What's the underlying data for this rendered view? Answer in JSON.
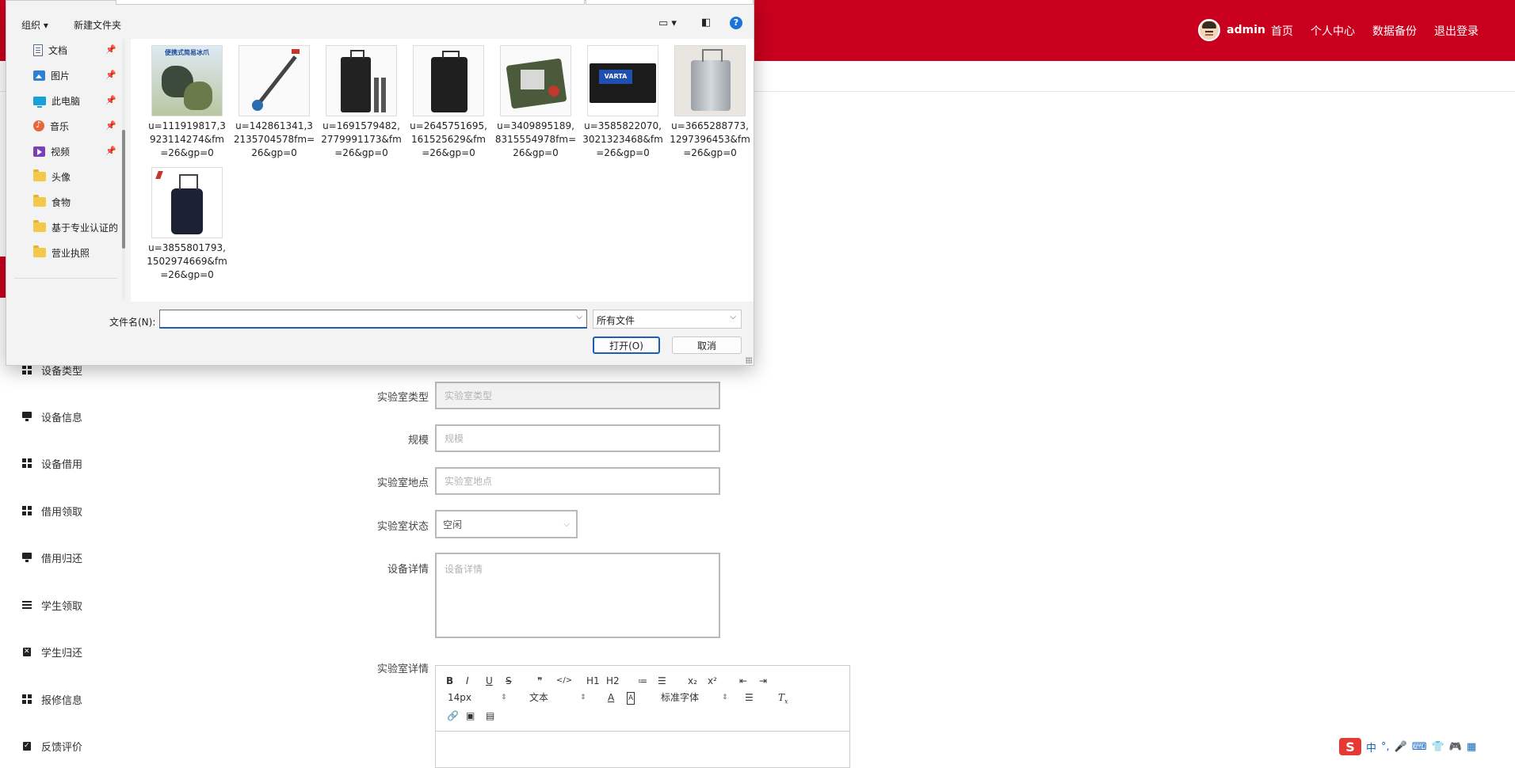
{
  "header": {
    "username": "admin",
    "nav": [
      "首页",
      "个人中心",
      "数据备份",
      "退出登录"
    ]
  },
  "sidebar": {
    "items": [
      {
        "label": "设备类型",
        "icon": "grid-icon"
      },
      {
        "label": "设备信息",
        "icon": "monitor-icon"
      },
      {
        "label": "设备借用",
        "icon": "grid-icon"
      },
      {
        "label": "借用领取",
        "icon": "grid-icon"
      },
      {
        "label": "借用归还",
        "icon": "monitor-icon"
      },
      {
        "label": "学生领取",
        "icon": "list-icon"
      },
      {
        "label": "学生归还",
        "icon": "clipboard-x-icon"
      },
      {
        "label": "报修信息",
        "icon": "grid-icon"
      },
      {
        "label": "反馈评价",
        "icon": "clipboard-check-icon"
      }
    ]
  },
  "form": {
    "lab_type": {
      "label": "实验室类型",
      "placeholder": "实验室类型"
    },
    "scale": {
      "label": "规模",
      "placeholder": "规模"
    },
    "location": {
      "label": "实验室地点",
      "placeholder": "实验室地点"
    },
    "status": {
      "label": "实验室状态",
      "value": "空闲"
    },
    "device_detail": {
      "label": "设备详情",
      "placeholder": "设备详情"
    },
    "lab_detail": {
      "label": "实验室详情"
    }
  },
  "editor": {
    "row1": [
      "B",
      "I",
      "U",
      "S",
      "❞",
      "</>",
      "H1",
      "H2",
      "≔",
      "☰",
      "x₂",
      "x²",
      "⇤",
      "⇥"
    ],
    "font_size": "14px",
    "text_type": "文本",
    "font_family": "标准字体"
  },
  "dialog": {
    "toolbar": {
      "organize": "组织 ▾",
      "new_folder": "新建文件夹"
    },
    "nav": [
      {
        "label": "文档",
        "icon": "document-icon",
        "pinned": true
      },
      {
        "label": "图片",
        "icon": "pictures-icon",
        "pinned": true
      },
      {
        "label": "此电脑",
        "icon": "computer-icon",
        "pinned": true
      },
      {
        "label": "音乐",
        "icon": "music-icon",
        "pinned": true
      },
      {
        "label": "视频",
        "icon": "video-icon",
        "pinned": true
      },
      {
        "label": "头像",
        "icon": "folder-icon",
        "pinned": false
      },
      {
        "label": "食物",
        "icon": "folder-icon",
        "pinned": false
      },
      {
        "label": "基于专业认证的",
        "icon": "folder-icon",
        "pinned": false
      },
      {
        "label": "营业执照",
        "icon": "folder-icon",
        "pinned": false
      }
    ],
    "files": [
      {
        "name": "u=111919817,3923114274&fm=26&gp=0",
        "thumb_text": "便携式简易冰爪"
      },
      {
        "name": "u=142861341,32135704578fm=26&gp=0"
      },
      {
        "name": "u=1691579482,2779991173&fm=26&gp=0"
      },
      {
        "name": "u=2645751695,161525629&fm=26&gp=0"
      },
      {
        "name": "u=3409895189,8315554978fm=26&gp=0"
      },
      {
        "name": "u=3585822070,3021323468&fm=26&gp=0",
        "thumb_text": "VARTA"
      },
      {
        "name": "u=3665288773,1297396453&fm=26&gp=0"
      },
      {
        "name": "u=3855801793,1502974669&fm=26&gp=0"
      }
    ],
    "filename_label": "文件名(N):",
    "filename_value": "",
    "filetype": "所有文件",
    "open_button": "打开(O)",
    "cancel_button": "取消"
  },
  "ime": {
    "s": "S",
    "mode": "中"
  },
  "colors": {
    "brand_red": "#c8001e",
    "accent_blue": "#1a5fb4"
  }
}
